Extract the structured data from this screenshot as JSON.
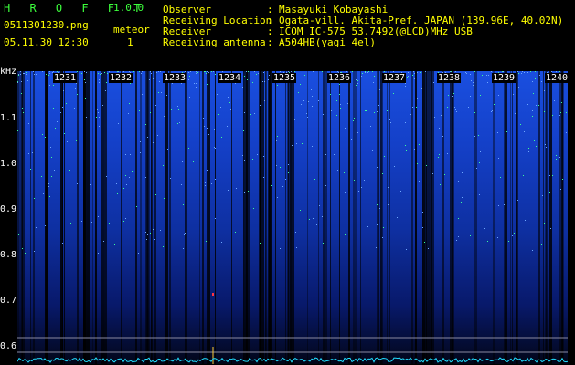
{
  "header": {
    "app_title": "H R O F F T",
    "app_version": "1.0.0",
    "file_name": "0511301230.png",
    "meteor_label": "meteor",
    "meteor_count": "1",
    "datetime": "05.11.30 12:30",
    "info": [
      {
        "label": "Observer",
        "value": "Masayuki Kobayashi"
      },
      {
        "label": "Receiving Location",
        "value": "Ogata-vill. Akita-Pref. JAPAN (139.96E, 40.02N)"
      },
      {
        "label": "Receiver",
        "value": "ICOM IC-575 53.7492(@LCD)MHz USB"
      },
      {
        "label": "Receiving antenna",
        "value": "A504HB(yagi 4el)"
      }
    ]
  },
  "spectrogram": {
    "y_unit": "kHz",
    "y_ticks": [
      "1.1",
      "1.0",
      "0.9",
      "0.8",
      "0.7",
      "0.6"
    ],
    "time_ticks": [
      "1231",
      "1232",
      "1233",
      "1234",
      "1235",
      "1236",
      "1237",
      "1238",
      "1239",
      "1240"
    ],
    "colors": {
      "noise": "#1a4fe0",
      "bright": "#3cff3c",
      "background": "#000000",
      "text": "#ffffff",
      "title": "#3cff3c",
      "labels": "#ffff00"
    }
  }
}
